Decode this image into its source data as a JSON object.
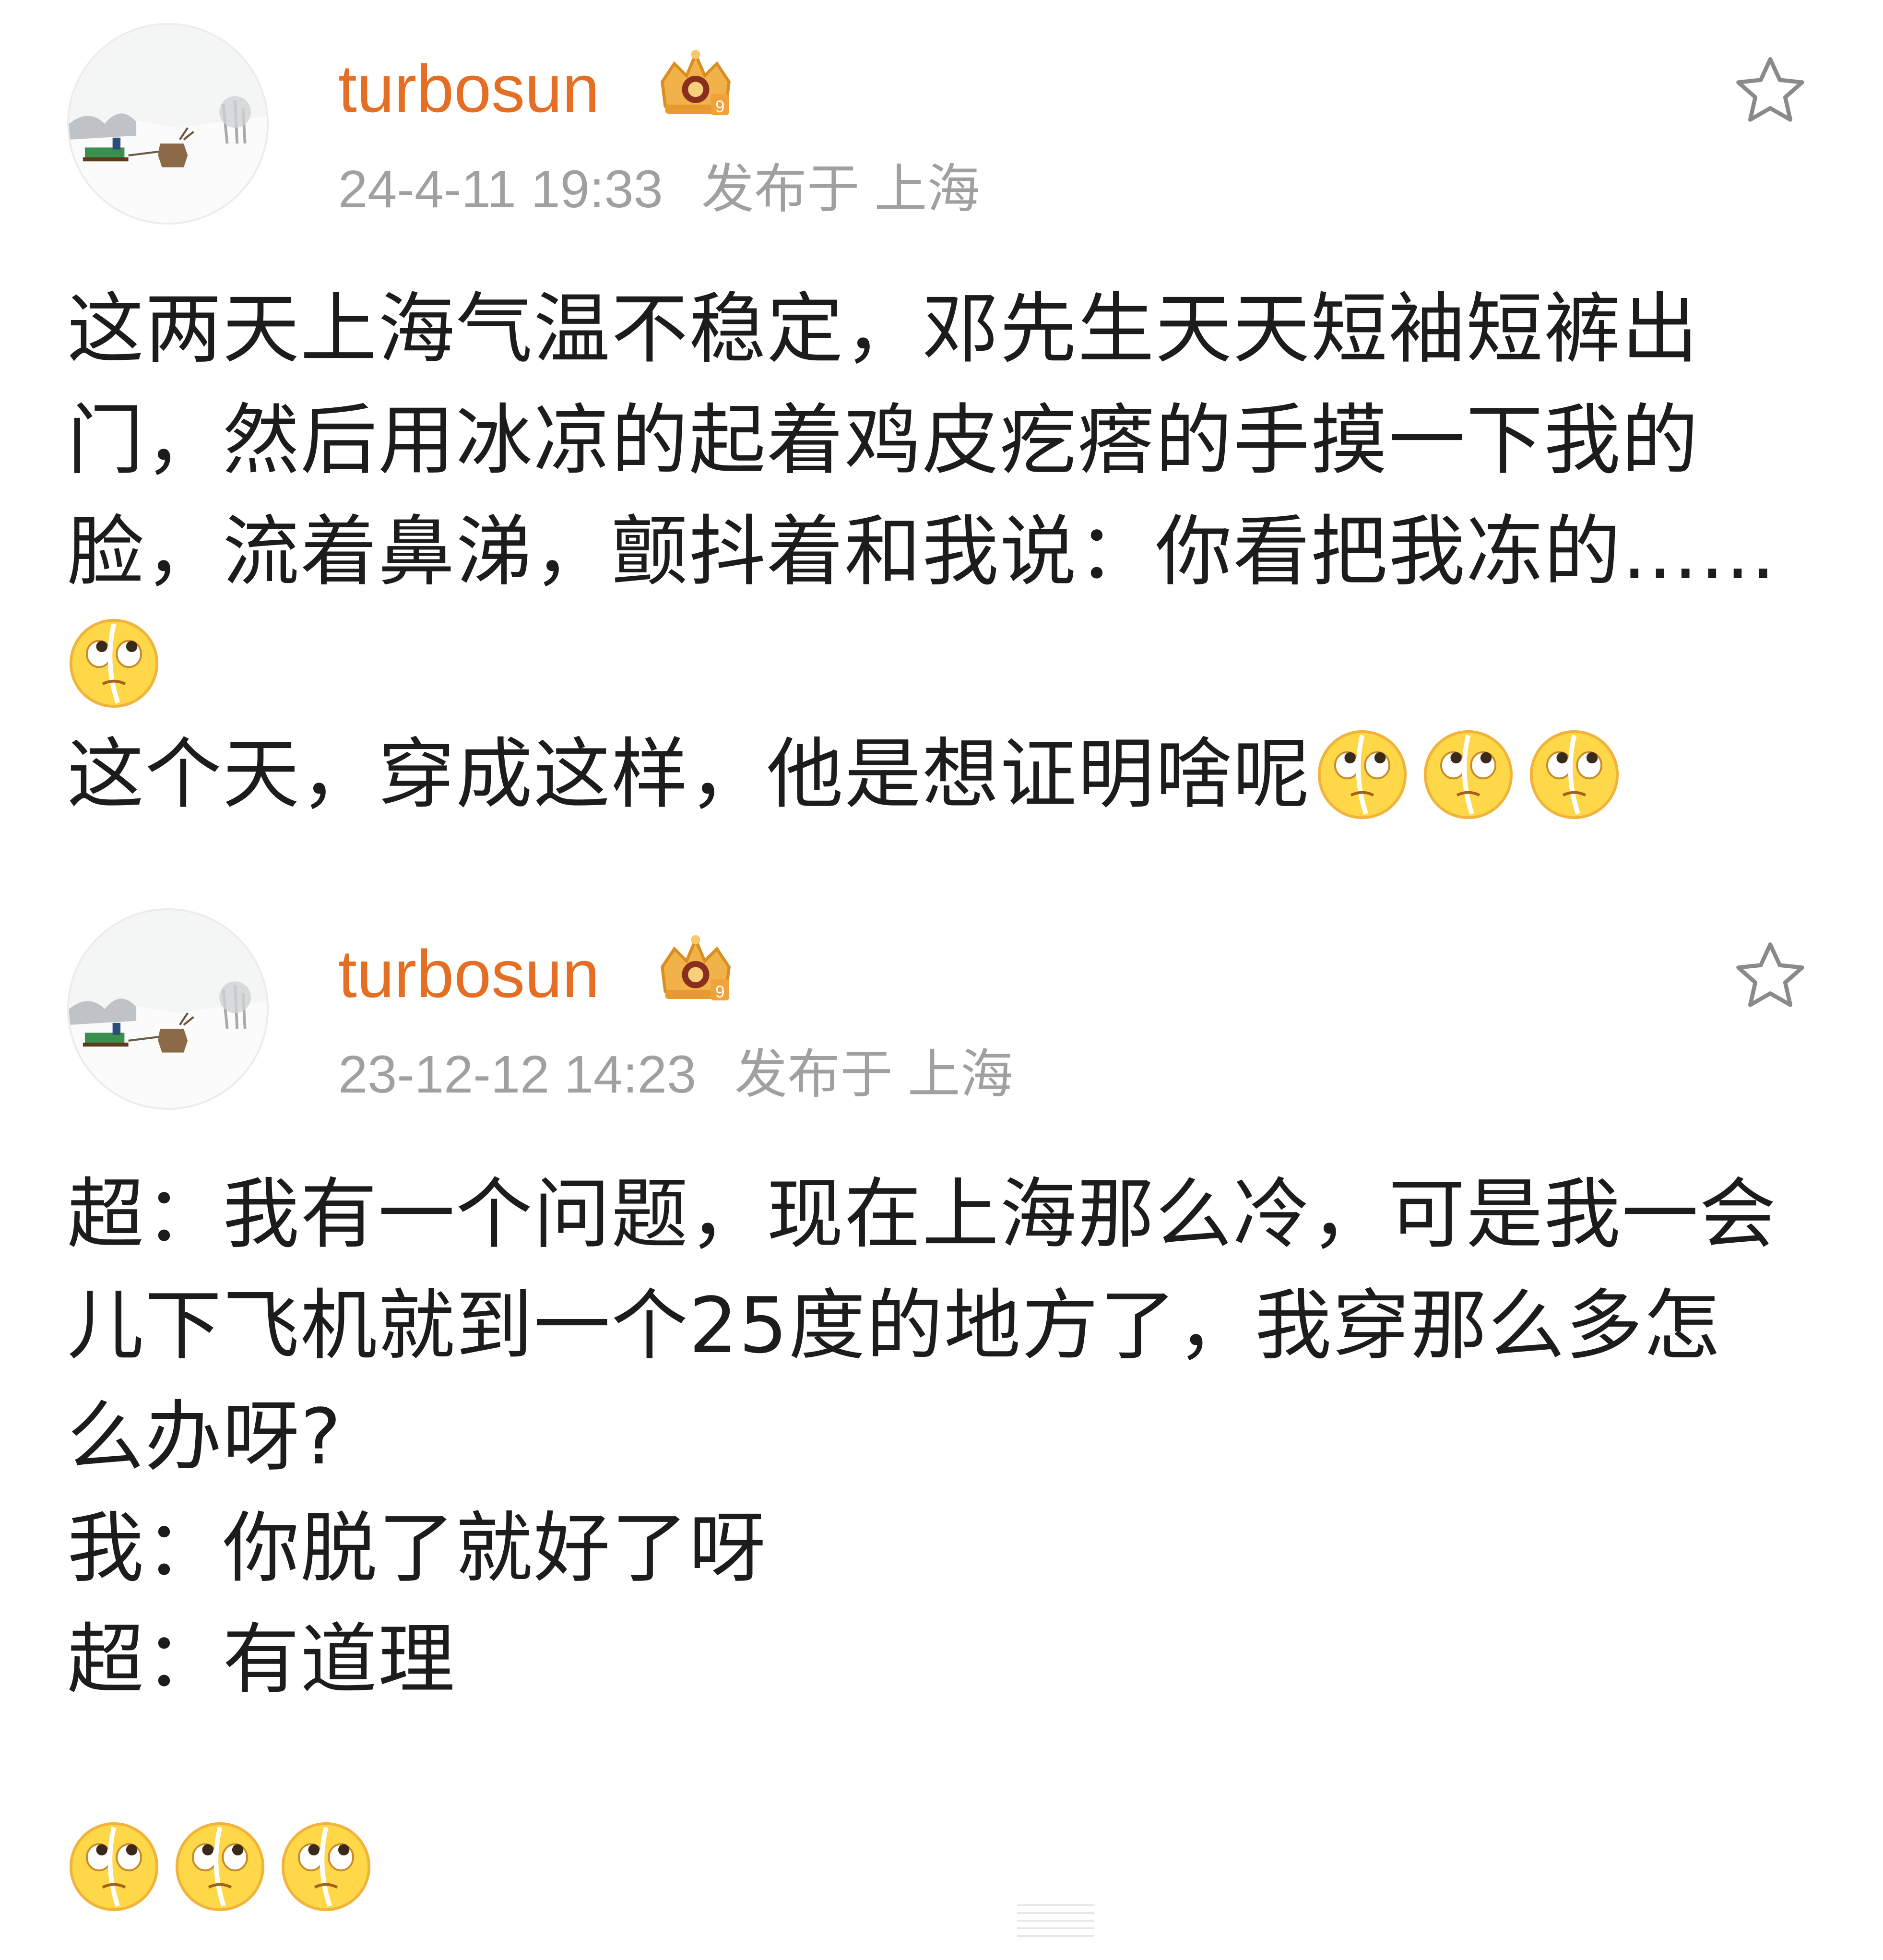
{
  "posts": [
    {
      "username": "turbosun",
      "timestamp": "24-4-11 19:33",
      "location": "发布于 上海",
      "lines": [
        "这两天上海气温不稳定，邓先生天天短袖短裤出",
        "门，然后用冰凉的起着鸡皮疙瘩的手摸一下我的",
        "脸，流着鼻涕，颤抖着和我说：你看把我冻的……",
        "",
        "这个天，穿成这样，他是想证明啥呢"
      ],
      "emoji": "eye-roll-emoji"
    },
    {
      "username": "turbosun",
      "timestamp": "23-12-12 14:23",
      "location": "发布于 上海",
      "lines": [
        "超：我有一个问题，现在上海那么冷，可是我一会",
        "儿下飞机就到一个25度的地方了，我穿那么多怎",
        "么办呀?",
        "我：你脱了就好了呀",
        "超：有道理"
      ],
      "emoji": "eye-roll-emoji"
    }
  ],
  "colors": {
    "username": "#e46f24",
    "meta": "#a0a0a0",
    "text": "#1c1c1c"
  },
  "icons": [
    "star-icon",
    "crown-badge-icon",
    "avatar-image",
    "eye-roll-emoji"
  ]
}
